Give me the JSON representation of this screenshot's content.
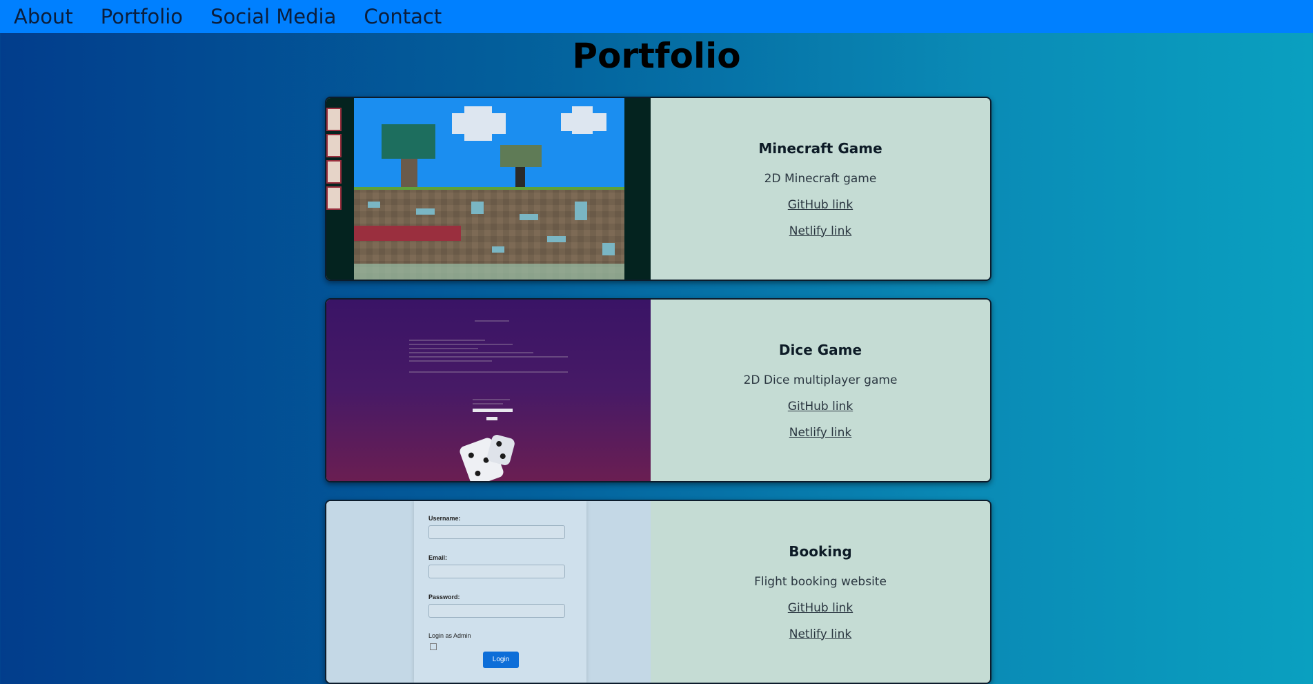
{
  "nav": {
    "items": [
      {
        "label": "About"
      },
      {
        "label": "Portfolio"
      },
      {
        "label": "Social Media"
      },
      {
        "label": "Contact"
      }
    ]
  },
  "page_title": "Portfolio",
  "projects": [
    {
      "title": "Minecraft Game",
      "description": "2D Minecraft game",
      "github_label": "GitHub link ",
      "netlify_label": "Netlify link ",
      "thumbnail": "minecraft-screenshot"
    },
    {
      "title": "Dice Game",
      "description": "2D Dice multiplayer game",
      "github_label": "GitHub link ",
      "netlify_label": "Netlify link ",
      "thumbnail": "dice-game-screenshot"
    },
    {
      "title": "Booking",
      "description": "Flight booking website",
      "github_label": "GitHub link ",
      "netlify_label": "Netlify link ",
      "thumbnail": "booking-form-screenshot",
      "form": {
        "username_label": "Username:",
        "email_label": "Email:",
        "password_label": "Password:",
        "admin_label": "Login as Admin",
        "login_button": "Login"
      }
    }
  ],
  "colors": {
    "navbar": "#0080ff",
    "card_info_bg": "#c5dcd4",
    "background_gradient_start": "#023d8c",
    "background_gradient_end": "#0aa0c0"
  }
}
